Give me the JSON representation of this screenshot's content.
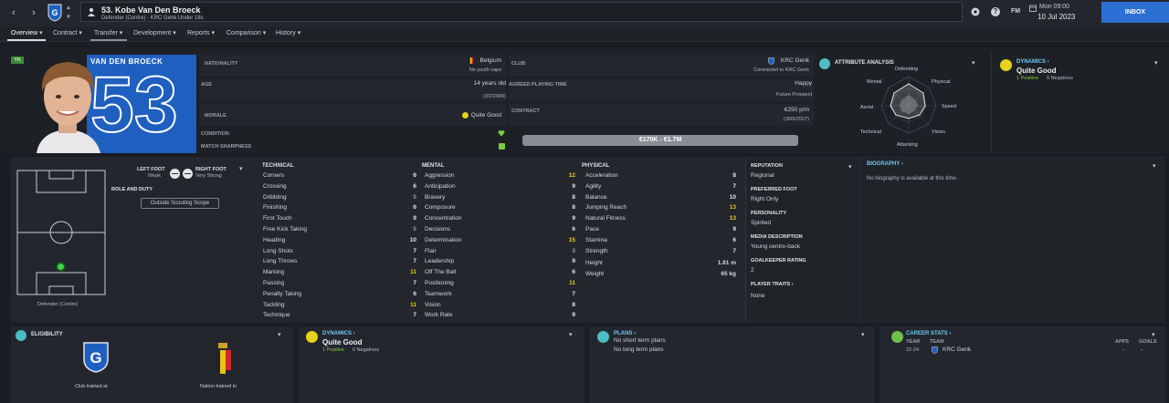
{
  "topbar": {
    "player_title": "53. Kobe Van Den Broeck",
    "player_sub": "Defender (Centre) - KRC Genk Under 18s",
    "fm_label": "FM",
    "date_day": "Mon 09:00",
    "date_full": "10 Jul 2023",
    "inbox_label": "INBOX"
  },
  "tabs": [
    {
      "label": "Overview"
    },
    {
      "label": "Contract"
    },
    {
      "label": "Transfer"
    },
    {
      "label": "Development"
    },
    {
      "label": "Reports"
    },
    {
      "label": "Comparison"
    },
    {
      "label": "History"
    }
  ],
  "profile": {
    "tag": "YN",
    "shirt_name": "VAN DEN BROECK",
    "shirt_number": "53",
    "nationality_label": "NATIONALITY",
    "nationality": "Belgium",
    "youth_caps": "No youth caps",
    "age_label": "AGE",
    "age": "14 years old",
    "dob": "(3/2/2009)",
    "morale_label": "MORALE",
    "morale": "Quite Good",
    "condition_label": "CONDITION",
    "sharpness_label": "MATCH SHARPNESS",
    "club_label": "CLUB",
    "club": "KRC Genk",
    "club_status": "Contracted to KRC Genk",
    "playing_time_label": "AGREED PLAYING TIME",
    "playing_time": "Happy",
    "playing_time_sub": "Future Prospect",
    "contract_label": "CONTRACT",
    "wage": "€250 p/m",
    "contract_end": "(30/6/2027)",
    "value_range": "€170K - €1.7M"
  },
  "attribute_analysis": {
    "title": "ATTRIBUTE ANALYSIS",
    "labels": {
      "defending": "Defending",
      "physical": "Physical",
      "speed": "Speed",
      "vision": "Vision",
      "attacking": "Attacking",
      "technical": "Technical",
      "aerial": "Aerial",
      "mental": "Mental"
    }
  },
  "dynamics_top": {
    "title": "DYNAMICS",
    "value": "Quite Good",
    "positives": "1 Positive",
    "negatives": "0 Negatives"
  },
  "position": {
    "left_foot_label": "LEFT FOOT",
    "left_foot": "Weak",
    "right_foot_label": "RIGHT FOOT",
    "right_foot": "Very Strong",
    "role_label": "ROLE AND DUTY",
    "scouting_button": "Outside Scouting Scope",
    "position_name": "Defender (Centre)"
  },
  "technical": {
    "header": "TECHNICAL",
    "items": [
      {
        "name": "Corners",
        "value": "6"
      },
      {
        "name": "Crossing",
        "value": "6"
      },
      {
        "name": "Dribbling",
        "value": "5"
      },
      {
        "name": "Finishing",
        "value": "6"
      },
      {
        "name": "First Touch",
        "value": "9"
      },
      {
        "name": "Free Kick Taking",
        "value": "5"
      },
      {
        "name": "Heading",
        "value": "10"
      },
      {
        "name": "Long Shots",
        "value": "7"
      },
      {
        "name": "Long Throws",
        "value": "7"
      },
      {
        "name": "Marking",
        "value": "11"
      },
      {
        "name": "Passing",
        "value": "7"
      },
      {
        "name": "Penalty Taking",
        "value": "6"
      },
      {
        "name": "Tackling",
        "value": "11"
      },
      {
        "name": "Technique",
        "value": "7"
      }
    ]
  },
  "mental": {
    "header": "MENTAL",
    "items": [
      {
        "name": "Aggression",
        "value": "12"
      },
      {
        "name": "Anticipation",
        "value": "9"
      },
      {
        "name": "Bravery",
        "value": "8"
      },
      {
        "name": "Composure",
        "value": "8"
      },
      {
        "name": "Concentration",
        "value": "9"
      },
      {
        "name": "Decisions",
        "value": "6"
      },
      {
        "name": "Determination",
        "value": "15"
      },
      {
        "name": "Flair",
        "value": "3"
      },
      {
        "name": "Leadership",
        "value": "9"
      },
      {
        "name": "Off The Ball",
        "value": "6"
      },
      {
        "name": "Positioning",
        "value": "11"
      },
      {
        "name": "Teamwork",
        "value": "7"
      },
      {
        "name": "Vision",
        "value": "8"
      },
      {
        "name": "Work Rate",
        "value": "9"
      }
    ]
  },
  "physical": {
    "header": "PHYSICAL",
    "items": [
      {
        "name": "Acceleration",
        "value": "8"
      },
      {
        "name": "Agility",
        "value": "7"
      },
      {
        "name": "Balance",
        "value": "10"
      },
      {
        "name": "Jumping Reach",
        "value": "13"
      },
      {
        "name": "Natural Fitness",
        "value": "13"
      },
      {
        "name": "Pace",
        "value": "9"
      },
      {
        "name": "Stamina",
        "value": "6"
      },
      {
        "name": "Strength",
        "value": "7"
      }
    ],
    "height_label": "Height",
    "height": "1.81 m",
    "weight_label": "Weight",
    "weight": "65 kg"
  },
  "info": {
    "reputation_label": "REPUTATION",
    "reputation": "Regional",
    "foot_label": "PREFERRED FOOT",
    "foot": "Right Only",
    "personality_label": "PERSONALITY",
    "personality": "Spirited",
    "media_label": "MEDIA DESCRIPTION",
    "media": "Young centre-back",
    "gk_label": "GOALKEEPER RATING",
    "gk": "2",
    "traits_label": "PLAYER TRAITS",
    "traits": "None"
  },
  "biography": {
    "title": "BIOGRAPHY",
    "text": "No biography is available at this time."
  },
  "eligibility": {
    "title": "ELIGIBILITY",
    "club_label": "Club trained at",
    "nation_label": "Nation trained in"
  },
  "dynamics_bottom": {
    "title": "DYNAMICS",
    "value": "Quite Good",
    "positives": "1 Positive",
    "negatives": "0 Negatives"
  },
  "plans": {
    "title": "PLANS",
    "short": "No short term plans",
    "long": "No long term plans"
  },
  "career": {
    "title": "CAREER STATS",
    "year_h": "YEAR",
    "team_h": "TEAM",
    "apps_h": "APPS",
    "goals_h": "GOALS",
    "year": "22-24",
    "team": "KRC Genk",
    "apps": "-",
    "goals": "-"
  },
  "colors": {
    "accent_blue": "#2b6fd3",
    "link": "#6fc8f0",
    "positive_green": "#7ccc3d",
    "highlight_yellow": "#e6d219",
    "genk_blue": "#1f5fbf"
  }
}
